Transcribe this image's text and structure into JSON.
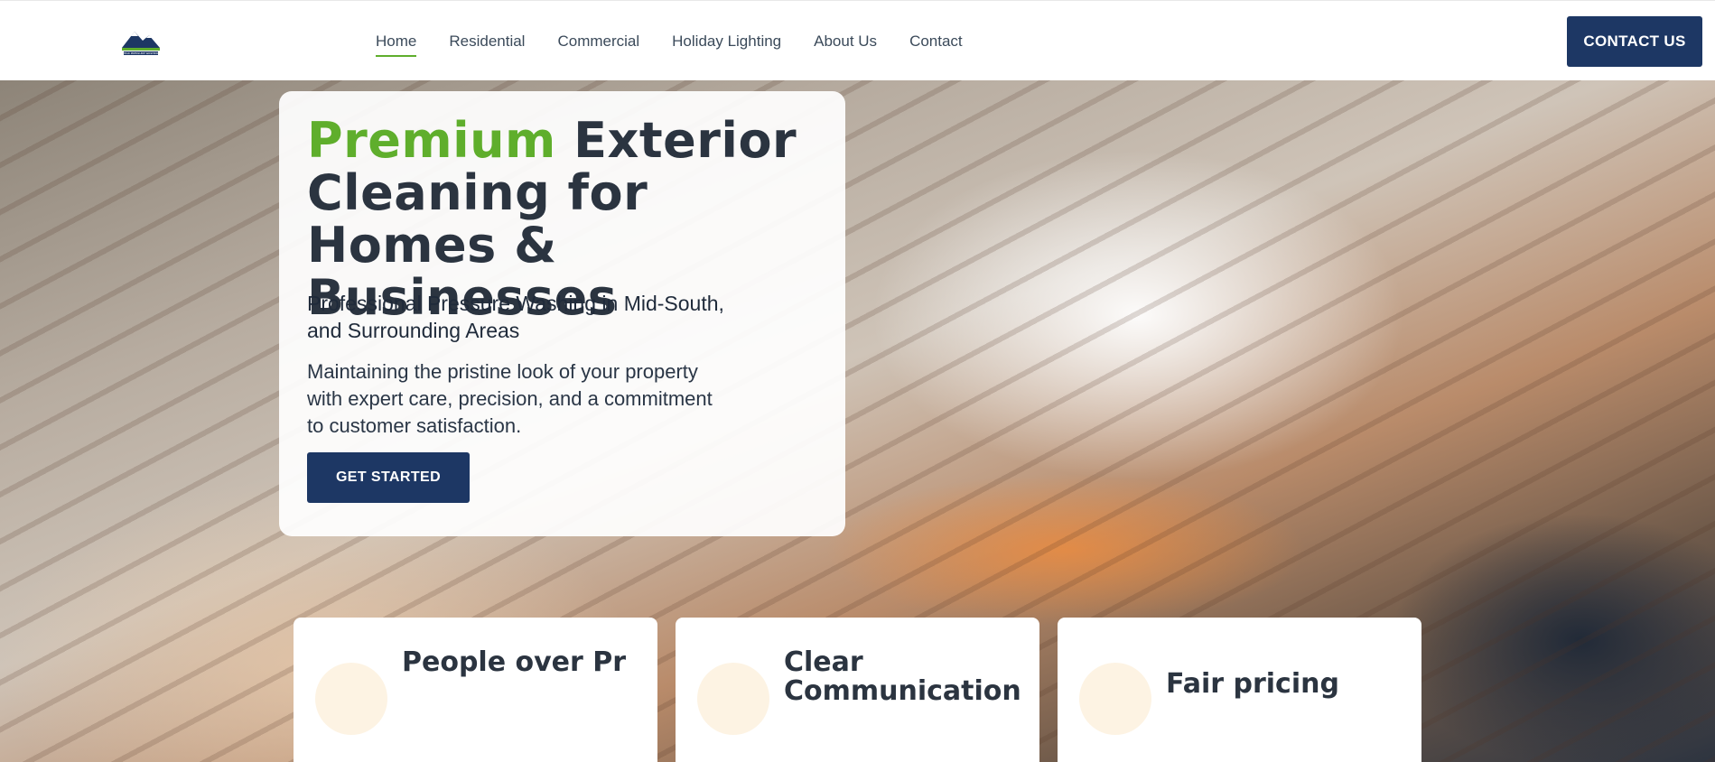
{
  "header": {
    "logo_text": "PEAK PRESSURE WASHING",
    "nav": [
      {
        "label": "Home",
        "active": true
      },
      {
        "label": "Residential",
        "active": false
      },
      {
        "label": "Commercial",
        "active": false
      },
      {
        "label": "Holiday Lighting",
        "active": false
      },
      {
        "label": "About Us",
        "active": false
      },
      {
        "label": "Contact",
        "active": false
      }
    ],
    "cta_label": "CONTACT US"
  },
  "hero": {
    "headline_accent": "Premium",
    "headline_rest": "Exterior Cleaning for Homes & Businesses",
    "subhead": "Professional Pressure Washing in Mid-South, and Surrounding Areas",
    "description": "Maintaining the pristine look of your property with expert care, precision, and a commitment to customer satisfaction.",
    "button_label": "GET STARTED"
  },
  "features": [
    {
      "title": "People over Pr"
    },
    {
      "title": "Clear Communication"
    },
    {
      "title": "Fair pricing"
    }
  ],
  "colors": {
    "accent_green": "#5fae2c",
    "navy": "#1d3764",
    "text_dark": "#2b3440"
  }
}
